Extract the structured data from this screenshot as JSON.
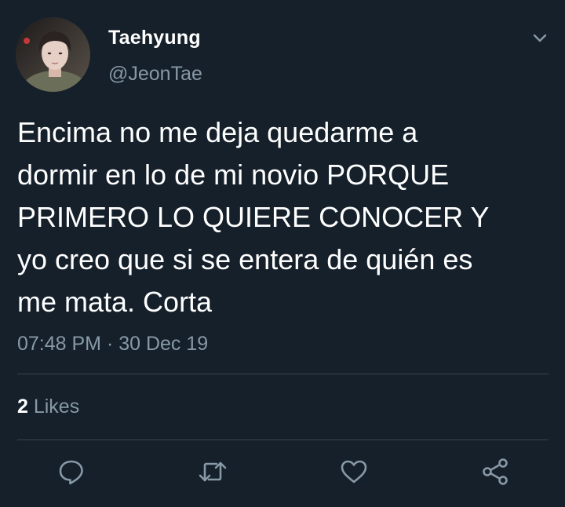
{
  "tweet": {
    "author": {
      "display_name": "Taehyung",
      "handle": "@JeonTae"
    },
    "text": "Encima no me deja quedarme a\ndormir en lo de mi novio PORQUE\nPRIMERO LO QUIERE CONOCER Y\nyo creo que si se entera de quién es\nme mata. Corta",
    "timestamp": "07:48 PM · 30 Dec 19",
    "likes": {
      "count": "2",
      "label": " Likes"
    }
  },
  "icons": {
    "menu": "chevron-down-icon",
    "reply": "reply-icon",
    "retweet": "retweet-icon",
    "like": "heart-icon",
    "share": "share-icon"
  },
  "colors": {
    "background": "#15202b",
    "primary_text": "#ffffff",
    "secondary_text": "#8899a6",
    "divider": "#38444d"
  }
}
